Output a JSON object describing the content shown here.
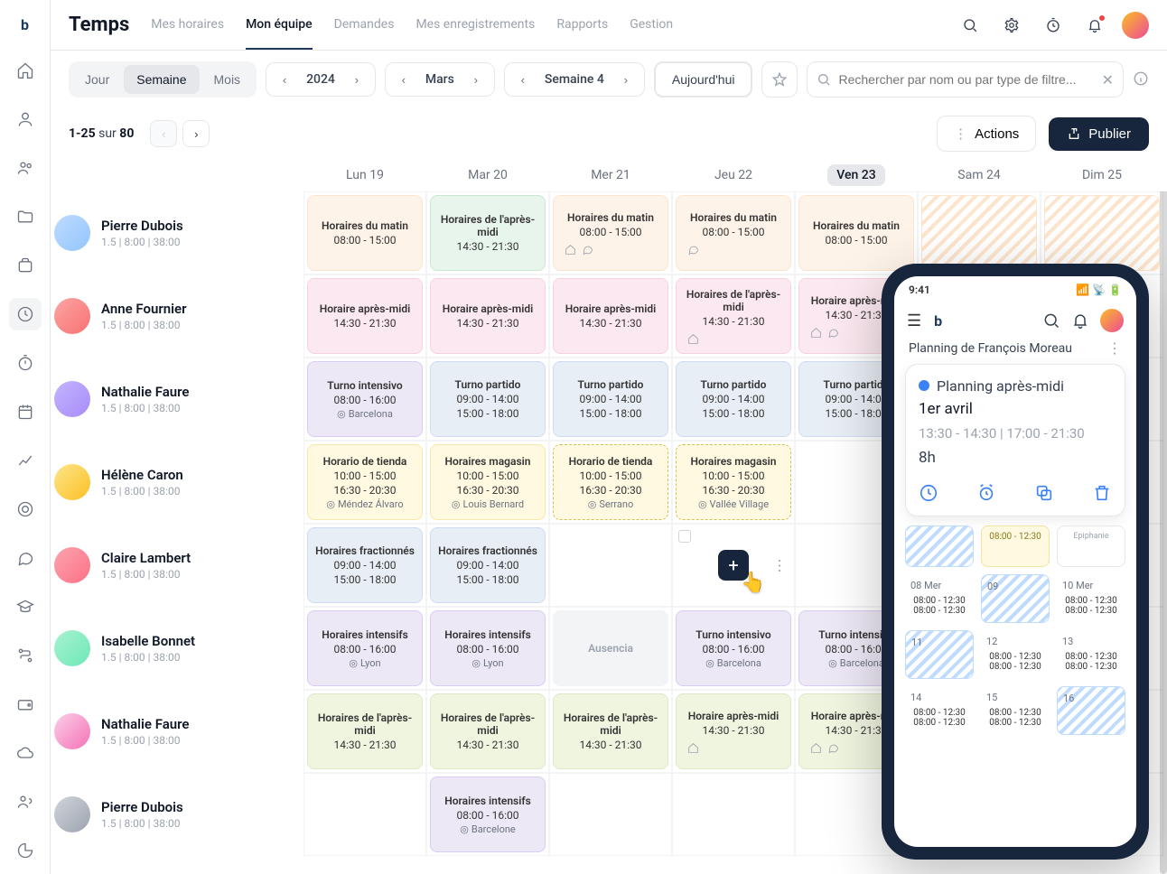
{
  "app": {
    "name": "Temps"
  },
  "tabs": [
    "Mes horaires",
    "Mon équipe",
    "Demandes",
    "Mes enregistrements",
    "Rapports",
    "Gestion"
  ],
  "active_tab": 1,
  "view": {
    "day": "Jour",
    "week": "Semaine",
    "month": "Mois"
  },
  "nav": {
    "year": "2024",
    "month": "Mars",
    "week": "Semaine 4",
    "today": "Aujourd'hui"
  },
  "search": {
    "placeholder": "Rechercher par nom ou par type de filtre..."
  },
  "paging": {
    "range": "1-25",
    "of": "sur",
    "total": "80"
  },
  "buttons": {
    "actions": "Actions",
    "publish": "Publier"
  },
  "days": [
    {
      "label": "Lun 19"
    },
    {
      "label": "Mar 20"
    },
    {
      "label": "Mer 21"
    },
    {
      "label": "Jeu 22"
    },
    {
      "label": "Ven 23",
      "today": true
    },
    {
      "label": "Sam 24"
    },
    {
      "label": "Dim 25"
    }
  ],
  "people_meta": "1.5 | 8:00 | 38:00",
  "people": [
    "Pierre Dubois",
    "Anne Fournier",
    "Nathalie Faure",
    "Hélène Caron",
    "Claire Lambert",
    "Isabelle Bonnet",
    "Nathalie Faure",
    "Pierre Dubois"
  ],
  "shifts": {
    "matin": {
      "t": "Horaires du matin",
      "time": "08:00 - 15:00"
    },
    "apm_green": {
      "t": "Horaires de l'après-midi",
      "time": "14:30 - 21:30"
    },
    "apm_pink": {
      "t": "Horaire après-midi",
      "time": "14:30 - 21:30"
    },
    "apm_pink2": {
      "t": "Horaires de l'après-midi",
      "time": "14:30 - 21:30"
    },
    "intensivo": {
      "t": "Turno intensivo",
      "time": "08:00 - 16:00",
      "loc": "Barcelona"
    },
    "partido": {
      "t": "Turno partido",
      "time1": "09:00 - 14:00",
      "time2": "15:00 - 18:00"
    },
    "tienda": {
      "t": "Horario de tienda",
      "time1": "10:00 - 15:00",
      "time2": "16:30 - 20:30",
      "loc": "Méndez Álvaro"
    },
    "tienda2": {
      "t": "Horario de tienda",
      "time1": "10:00 - 15:00",
      "time2": "16:30 - 20:30",
      "loc": "Serrano"
    },
    "magasin": {
      "t": "Horaires magasin",
      "time1": "10:00 - 15:00",
      "time2": "16:30 - 20:30",
      "loc": "Louis Bernard"
    },
    "magasin2": {
      "t": "Horaires magasin",
      "time1": "10:00 - 15:00",
      "time2": "16:30 - 20:30",
      "loc": "Vallée Village"
    },
    "fraction": {
      "t": "Horaires fractionnés",
      "time1": "09:00 - 14:00",
      "time2": "15:00 - 18:00"
    },
    "intensifs": {
      "t": "Horaires intensifs",
      "time": "08:00 - 16:00",
      "loc": "Lyon"
    },
    "intensifs_bcn": {
      "t": "Horaires intensifs",
      "time": "08:00 - 16:00",
      "loc": "Barcelone"
    },
    "ausencia": {
      "t": "Ausencia"
    },
    "apm_lime": {
      "t": "Horaires de l'après-midi",
      "time": "14:30 - 21:30"
    },
    "apm_lime2": {
      "t": "Horaire après-midi",
      "time": "14:30 - 21:30"
    }
  },
  "phone": {
    "time": "9:41",
    "title": "Planning de François Moreau",
    "card": {
      "name": "Planning après-midi",
      "date": "1er avril",
      "hours": "13:30 - 14:30 | 17:00 - 21:30",
      "dur": "8h"
    },
    "mini": {
      "epiph": "Epiphanie",
      "t1": "08:00 - 12:30",
      "d": [
        "08 Mer",
        "09",
        "10 Mer",
        "11",
        "12",
        "13",
        "14",
        "15",
        "16"
      ]
    }
  }
}
